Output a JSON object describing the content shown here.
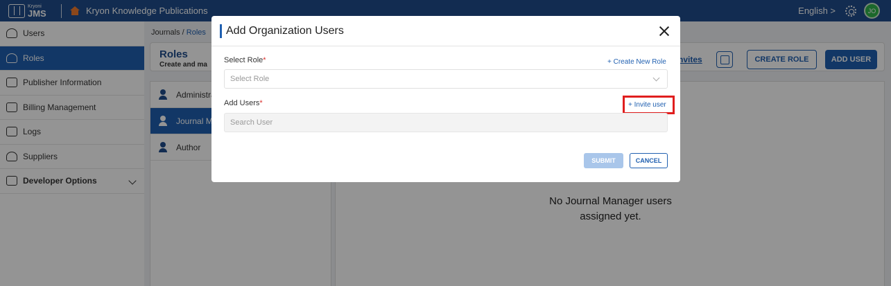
{
  "topbar": {
    "brand_small": "Kryoni",
    "brand_big": "JMS",
    "org_name": "Kryon Knowledge Publications",
    "language": "English >",
    "avatar_initials": "JO"
  },
  "sidebar": {
    "items": [
      {
        "label": "Users",
        "icon": "user-icon"
      },
      {
        "label": "Roles",
        "icon": "roles-icon",
        "active": true
      },
      {
        "label": "Publisher Information",
        "icon": "sliders-icon"
      },
      {
        "label": "Billing Management",
        "icon": "billing-icon"
      },
      {
        "label": "Logs",
        "icon": "logs-icon"
      },
      {
        "label": "Suppliers",
        "icon": "suppliers-icon"
      },
      {
        "label": "Developer Options",
        "icon": "gear-icon"
      }
    ]
  },
  "breadcrumb": {
    "root": "Journals",
    "sep": "/",
    "current": "Roles"
  },
  "roles_header": {
    "title": "Roles",
    "subtitle": "Create and ma",
    "invites_link": "nvites",
    "create_role_label": "CREATE ROLE",
    "add_user_label": "ADD USER"
  },
  "role_list": [
    "Administra",
    "Journal Ma",
    "Author"
  ],
  "empty_state": {
    "line1": "No Journal Manager users",
    "line2": "assigned yet."
  },
  "modal": {
    "title": "Add Organization Users",
    "select_role_label": "Select Role",
    "required_mark": "*",
    "create_new_role_link": "+ Create New Role",
    "select_role_placeholder": "Select Role",
    "add_users_label": "Add Users",
    "invite_user_link": "+ Invite user",
    "search_placeholder": "Search User",
    "submit_label": "SUBMIT",
    "cancel_label": "CANCEL"
  }
}
